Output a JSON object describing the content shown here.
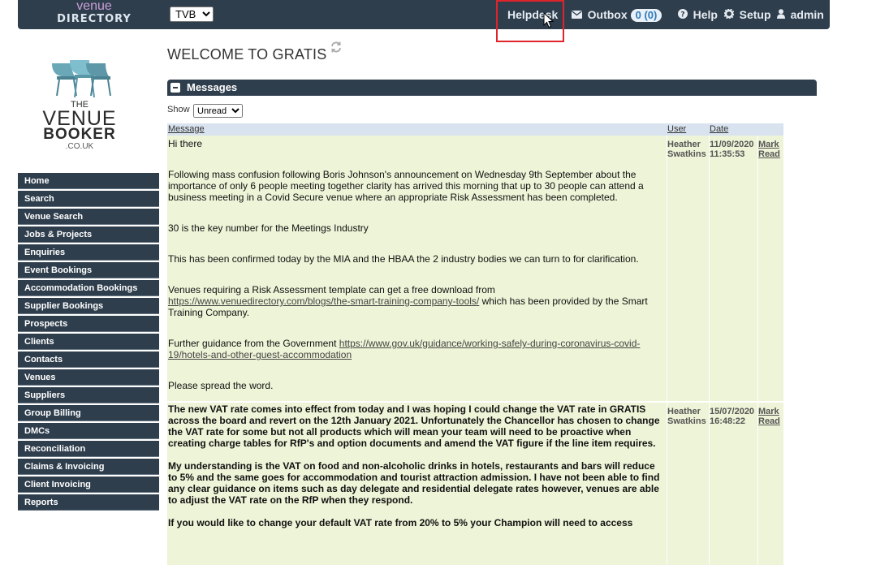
{
  "topbar": {
    "logo_line1": "venue",
    "logo_line2": "DIRECTORY",
    "company_select": "TVB",
    "helpdesk": "Helpdesk",
    "outbox": "Outbox",
    "outbox_count": "0 (0)",
    "help": "Help",
    "setup": "Setup",
    "user": "admin"
  },
  "brand": {
    "the": "THE",
    "venue": "VENUE",
    "booker": "BOOKER",
    "couk": ".CO.UK"
  },
  "sidebar": {
    "items": [
      {
        "label": "Home"
      },
      {
        "label": "Search"
      },
      {
        "label": "Venue Search"
      },
      {
        "label": "Jobs & Projects"
      },
      {
        "label": "Enquiries"
      },
      {
        "label": "Event Bookings"
      },
      {
        "label": "Accommodation Bookings"
      },
      {
        "label": "Supplier Bookings"
      },
      {
        "label": "Prospects"
      },
      {
        "label": "Clients"
      },
      {
        "label": "Contacts"
      },
      {
        "label": "Venues"
      },
      {
        "label": "Suppliers"
      },
      {
        "label": "Group Billing"
      },
      {
        "label": "DMCs"
      },
      {
        "label": "Reconciliation"
      },
      {
        "label": "Claims & Invoicing"
      },
      {
        "label": "Client Invoicing"
      },
      {
        "label": "Reports"
      }
    ]
  },
  "main": {
    "title": "WELCOME TO GRATIS",
    "panel_title": "Messages",
    "show_label": "Show",
    "show_value": "Unread",
    "columns": {
      "message": "Message",
      "user": "User",
      "date": "Date"
    }
  },
  "messages": [
    {
      "user": "Heather Swatkins",
      "date": "11/09/2020",
      "time": "11:35:53",
      "action": "Mark Read",
      "greeting": "Hi there",
      "p1": "Following mass confusion following Boris Johnson's announcement on Wednesday 9th September about the importance of only 6 people meeting together clarity has arrived this morning that up to 30 people can attend a business meeting in a Covid Secure venue where an appropriate Risk Assessment has been completed.",
      "p2": "30 is the key number for the Meetings Industry",
      "p3": "This has been confirmed today by the MIA and the HBAA  the 2 industry bodies we can turn to for clarification.",
      "p4a": "Venues requiring a Risk Assessment template can get a free download from",
      "p4link": "https://www.venuedirectory.com/blogs/the-smart-training-company-tools/",
      "p4b": " which has been provided by the Smart Training Company.",
      "p5a": "Further guidance from the Government ",
      "p5link": "https://www.gov.uk/guidance/working-safely-during-coronavirus-covid-19/hotels-and-other-guest-accommodation",
      "p6": "Please spread the word."
    },
    {
      "user": "Heather Swatkins",
      "date": "15/07/2020",
      "time": "16:48:22",
      "action": "Mark Read",
      "p1": "The new VAT rate comes into effect from today and I was hoping I could change the VAT rate in GRATIS across the board and revert on the 12th January 2021. Unfortunately the Chancellor has chosen to change the VAT rate for some but not all products which will mean your team will need to be proactive when creating charge tables for RfP's and option documents and amend the VAT figure if the line item requires.",
      "p2": "My understanding is the VAT on food and non-alcoholic drinks in hotels, restaurants and bars will reduce to 5% and the same goes for accommodation and tourist attraction admission. I have not been able to find any clear guidance on items such as day delegate and residential delegate rates however, venues are able to adjust the VAT rate on the RfP when they respond.",
      "p3": "If you would like to change your default VAT rate from 20% to 5% your Champion will need to access"
    }
  ]
}
